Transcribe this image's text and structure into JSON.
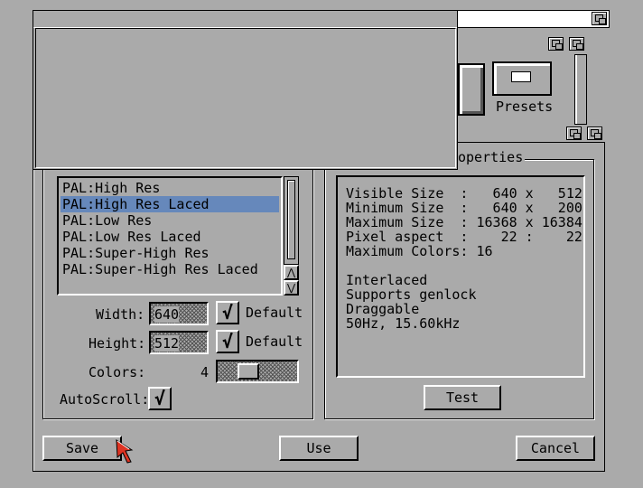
{
  "presets_label": "Presets",
  "properties_title_fragment": "operties",
  "modes": [
    "PAL:High Res",
    "PAL:High Res Laced",
    "PAL:Low Res",
    "PAL:Low Res Laced",
    "PAL:Super-High Res",
    "PAL:Super-High Res Laced"
  ],
  "selected_mode_index": 1,
  "width": {
    "label": "Width:",
    "value": "640",
    "default_checked": true,
    "default_label": "Default"
  },
  "height": {
    "label": "Height:",
    "value": "512",
    "default_checked": true,
    "default_label": "Default"
  },
  "colors": {
    "label": "Colors:",
    "value": "4"
  },
  "autoscroll": {
    "label": "AutoScroll:",
    "checked": true
  },
  "check_glyph": "√",
  "properties": {
    "line1": "Visible Size  :   640 x   512",
    "line2": "Minimum Size  :   640 x   200",
    "line3": "Maximum Size  : 16368 x 16384",
    "line4": "Pixel aspect  :    22 :    22",
    "line5": "Maximum Colors: 16",
    "line6": "",
    "line7": "Interlaced",
    "line8": "Supports genlock",
    "line9": "Draggable",
    "line10": "50Hz, 15.60kHz"
  },
  "buttons": {
    "test": "Test",
    "save": "Save",
    "use": "Use",
    "cancel": "Cancel"
  },
  "scroll_up_glyph": "⋀",
  "scroll_down_glyph": "⋁"
}
